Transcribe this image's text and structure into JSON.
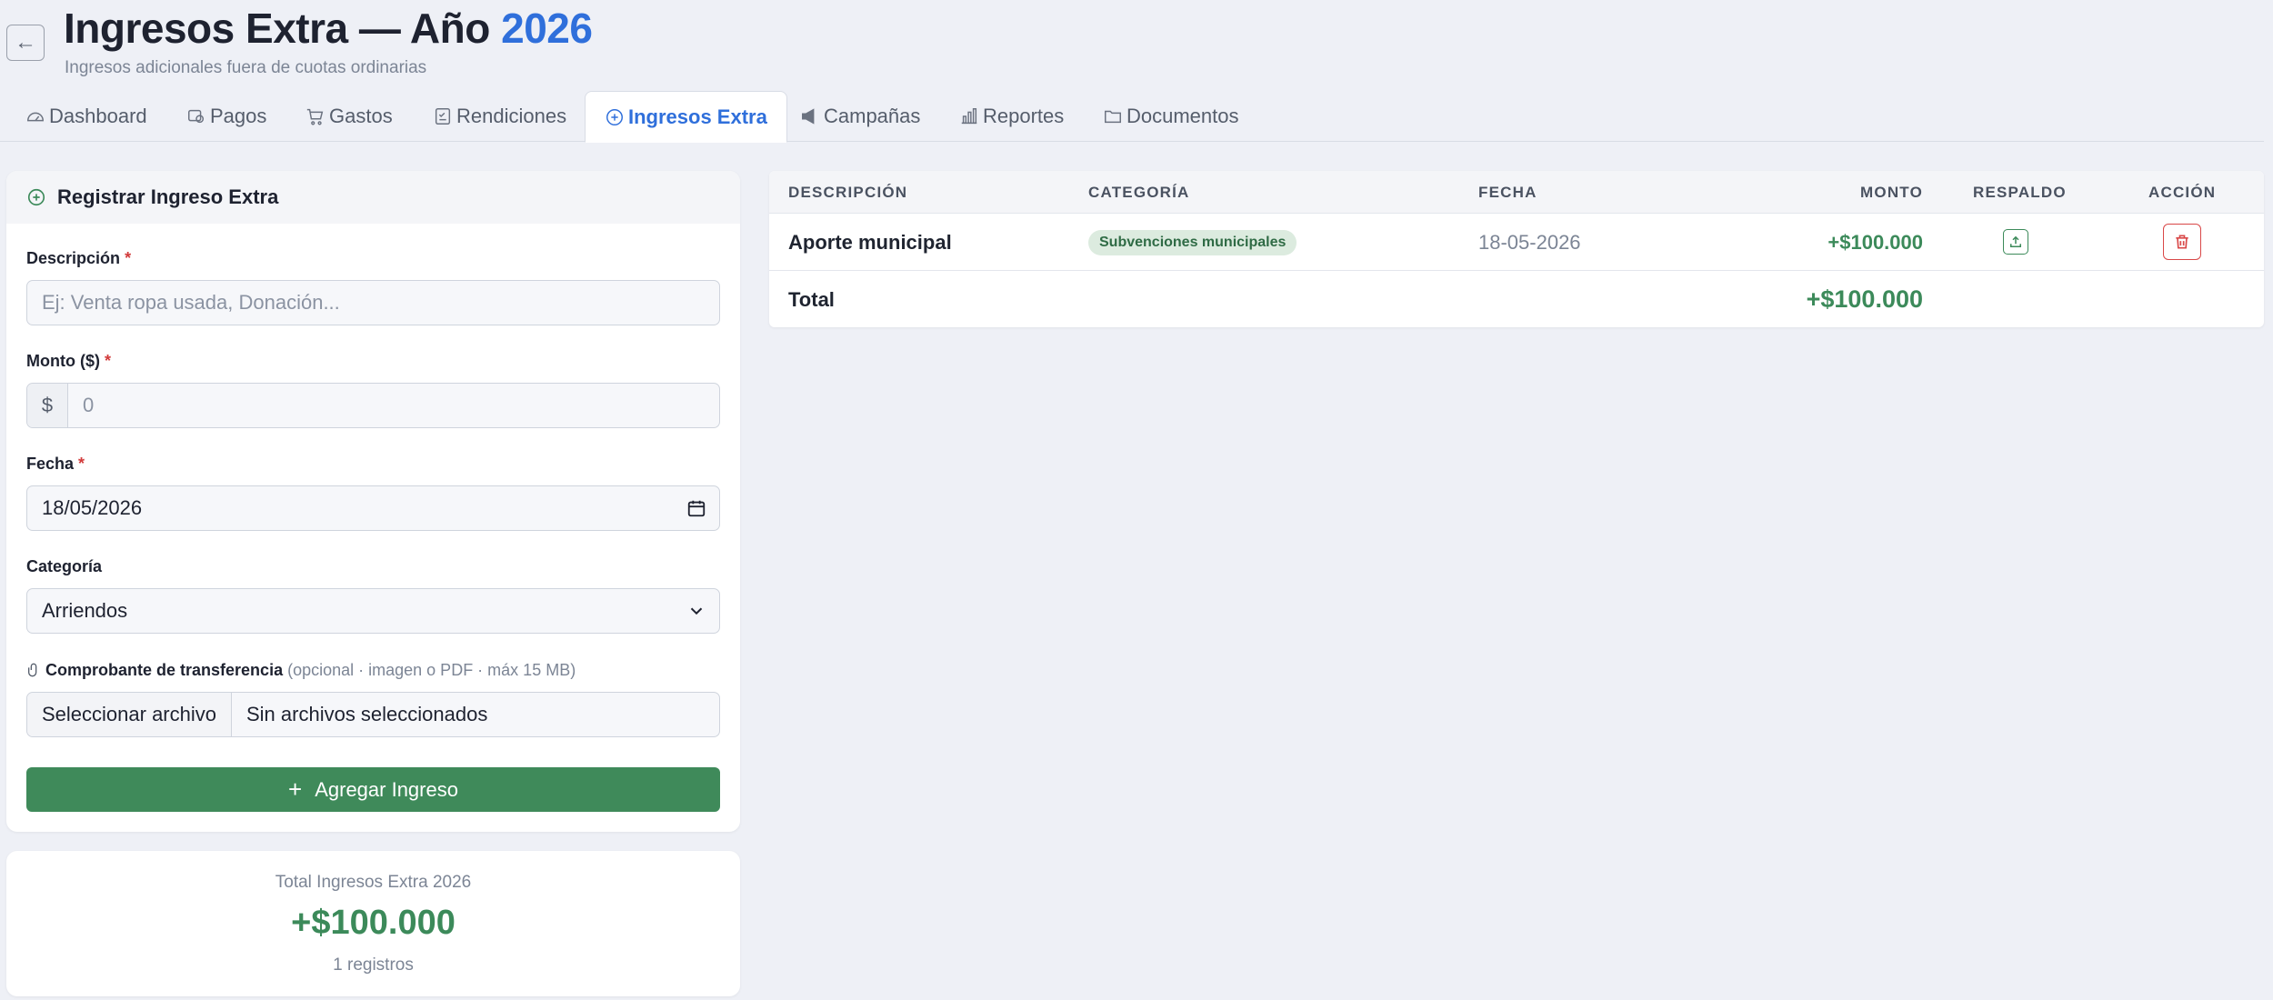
{
  "header": {
    "back_icon": "arrow-left-icon",
    "title_prefix": "Ingresos Extra — Año",
    "title_year": "2026",
    "subtitle": "Ingresos adicionales fuera de cuotas ordinarias"
  },
  "tabs": [
    {
      "label": "Dashboard",
      "icon": "speedometer-icon"
    },
    {
      "label": "Pagos",
      "icon": "wallet-icon"
    },
    {
      "label": "Gastos",
      "icon": "cart-icon"
    },
    {
      "label": "Rendiciones",
      "icon": "checklist-icon"
    },
    {
      "label": "Ingresos Extra",
      "icon": "plus-circle-icon",
      "active": true
    },
    {
      "label": "Campañas",
      "icon": "megaphone-icon"
    },
    {
      "label": "Reportes",
      "icon": "bar-chart-icon"
    },
    {
      "label": "Documentos",
      "icon": "folder-icon"
    }
  ],
  "form": {
    "title": "Registrar Ingreso Extra",
    "descripcion_label": "Descripción",
    "descripcion_placeholder": "Ej: Venta ropa usada, Donación...",
    "monto_label": "Monto ($)",
    "monto_prefix": "$",
    "monto_placeholder": "0",
    "fecha_label": "Fecha",
    "fecha_value": "18/05/2026",
    "categoria_label": "Categoría",
    "categoria_value": "Arriendos",
    "comprobante_label": "Comprobante de transferencia",
    "comprobante_hint": "(opcional · imagen o PDF · máx 15 MB)",
    "file_button": "Seleccionar archivo",
    "file_status": "Sin archivos seleccionados",
    "submit_label": "Agregar Ingreso",
    "required_mark": "*"
  },
  "summary": {
    "label": "Total Ingresos Extra 2026",
    "value": "+$100.000",
    "count": "1 registros"
  },
  "table": {
    "headers": {
      "descripcion": "DESCRIPCIÓN",
      "categoria": "CATEGORÍA",
      "fecha": "FECHA",
      "monto": "MONTO",
      "respaldo": "RESPALDO",
      "accion": "ACCIÓN"
    },
    "rows": [
      {
        "descripcion": "Aporte municipal",
        "categoria": "Subvenciones municipales",
        "fecha": "18-05-2026",
        "monto": "+$100.000"
      }
    ],
    "total_label": "Total",
    "total_value": "+$100.000"
  },
  "colors": {
    "accent_blue": "#2f6fdb",
    "success_green": "#3c8a5a",
    "danger_red": "#d94848",
    "background": "#eef0f6"
  }
}
